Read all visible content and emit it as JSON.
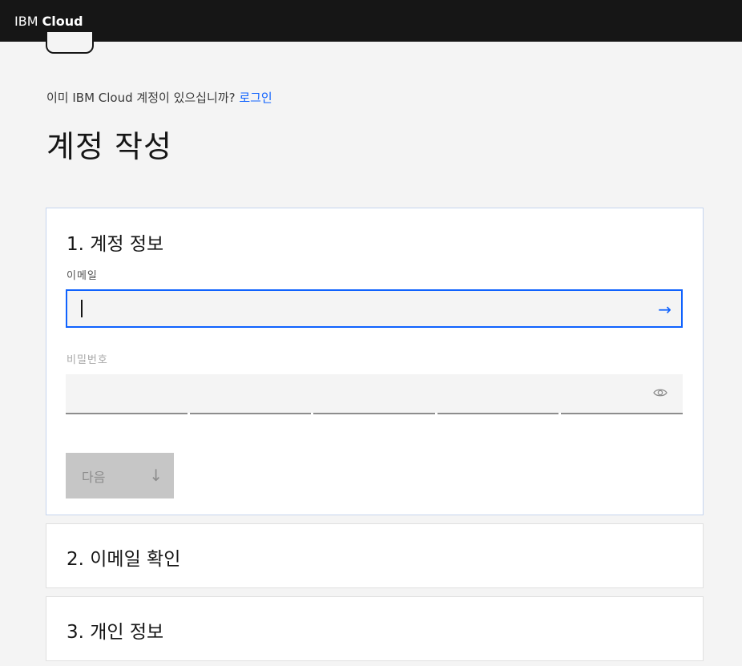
{
  "header": {
    "brand_light": "IBM",
    "brand_bold": "Cloud"
  },
  "signin": {
    "prompt": "이미 IBM Cloud 계정이 있으십니까?",
    "link": "로그인"
  },
  "page_title": "계정 작성",
  "steps": [
    {
      "title": "1. 계정 정보",
      "email_label": "이메일",
      "email_value": "",
      "password_label": "비밀번호",
      "password_value": "",
      "next_label": "다음",
      "next_icon": "arrow-down-icon",
      "submit_icon": "arrow-right-icon",
      "reveal_icon": "eye-icon"
    },
    {
      "title": "2. 이메일 확인"
    },
    {
      "title": "3. 개인 정보"
    }
  ],
  "colors": {
    "header_bg": "#161616",
    "accent": "#0f62fe",
    "page_bg": "#f4f4f4",
    "disabled_button": "#c6c6c6"
  }
}
